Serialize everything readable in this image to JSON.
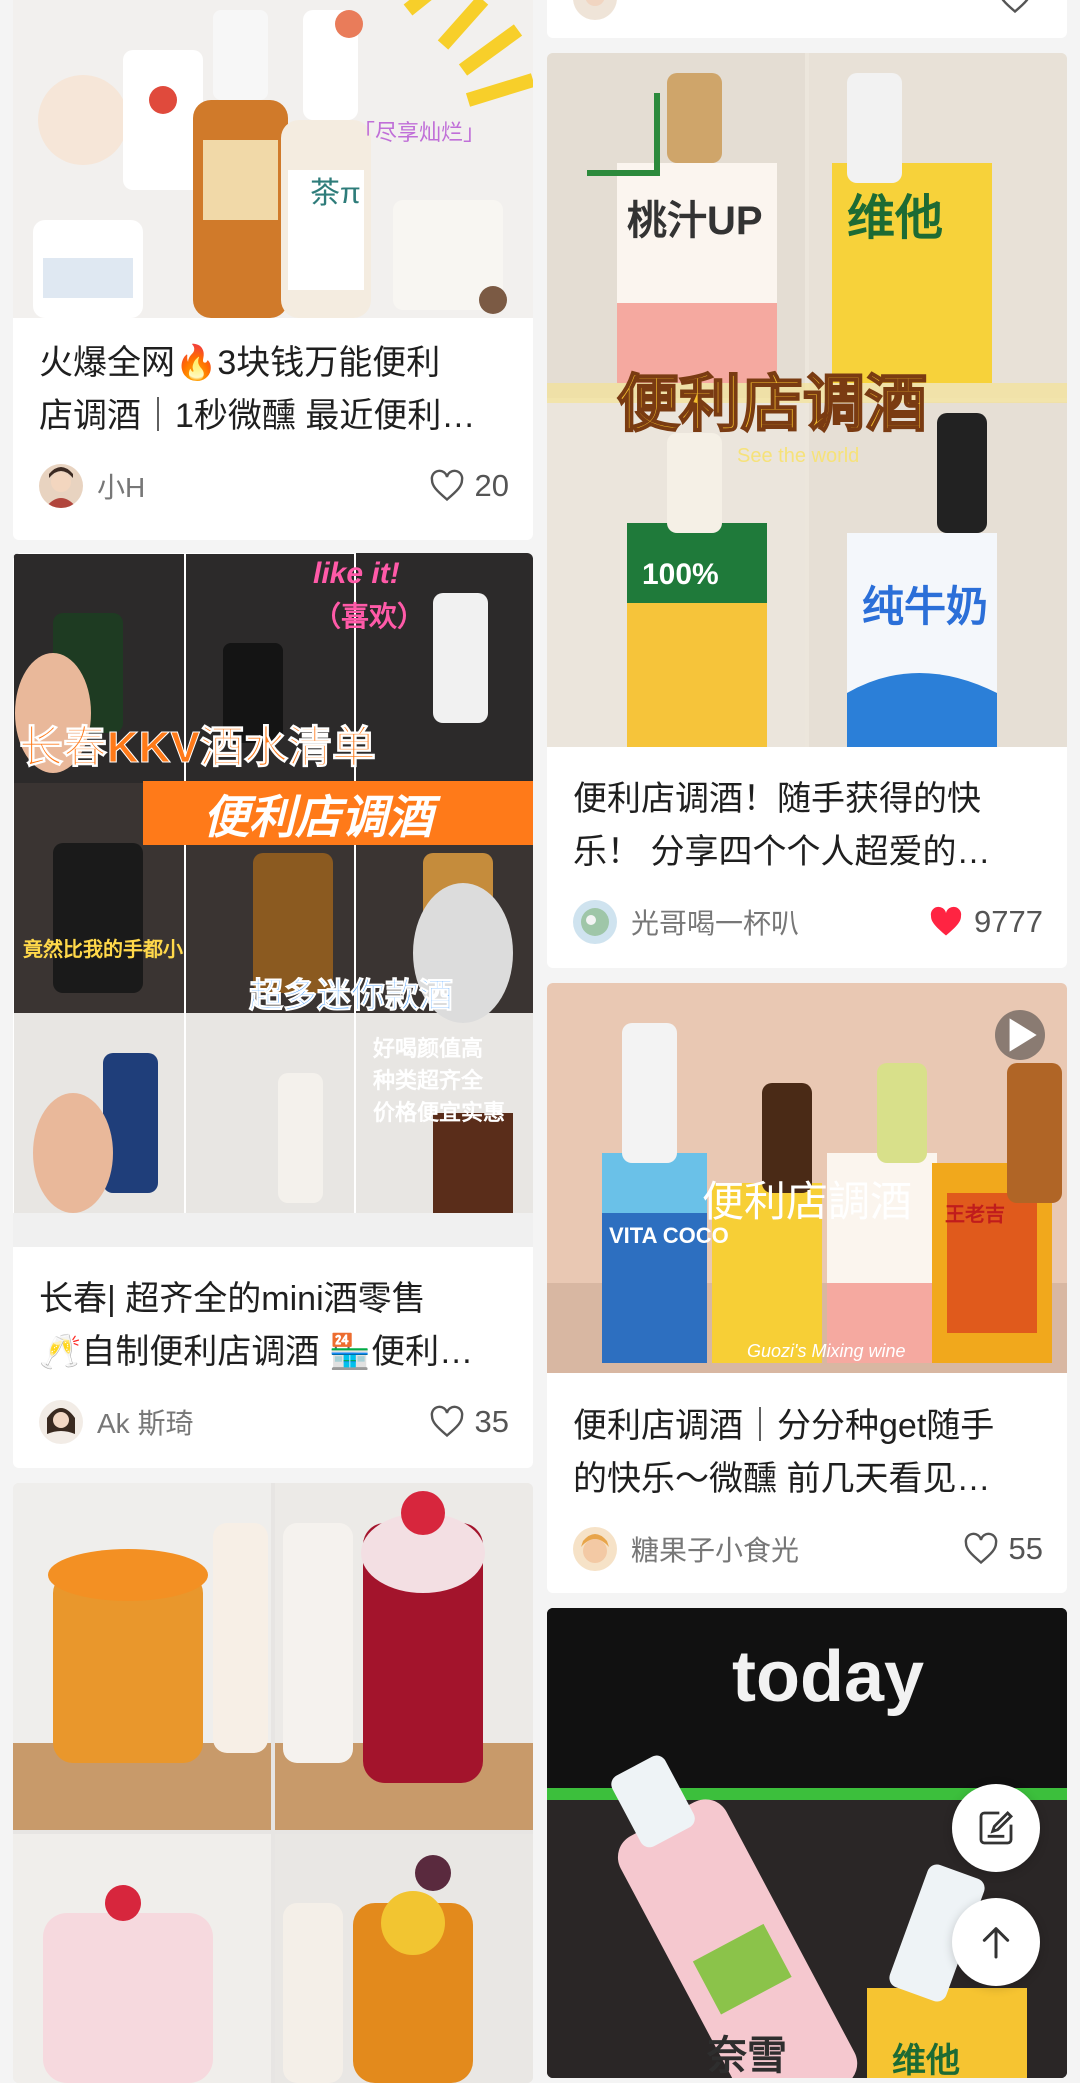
{
  "feed": {
    "cards": [
      {
        "title": "火爆全网🔥3块钱万能便利\n店调酒｜1秒微醺 最近便利…",
        "author": "小H",
        "likes": "20",
        "liked": false,
        "image_text": [
          "「尽享灿烂」",
          "茶π"
        ]
      },
      {
        "title": "长春| 超齐全的mini酒零售\n🥂自制便利店调酒 🏪便利…",
        "author": "Ak 斯琦",
        "likes": "35",
        "liked": false,
        "image_text": [
          "like it!",
          "（喜欢）",
          "长春KKV酒水清单",
          "便利店调酒",
          "超多迷你款酒",
          "好喝颜值高",
          "种类超齐全",
          "价格便宜实惠",
          "竟然比我的手都小"
        ]
      },
      {
        "title": "",
        "author": "",
        "likes": "",
        "image_text": []
      },
      {
        "title": "便利店调酒！随手获得的快\n乐！ 分享四个个人超爱的…",
        "author": "光哥喝一杯叭",
        "likes": "9777",
        "liked": true,
        "image_text": [
          "便利店调酒",
          "See the world",
          "纯牛奶",
          "桃汁UP",
          "100%",
          "维他"
        ]
      },
      {
        "title": "便利店调酒｜分分种get随手\n的快乐～微醺 前几天看见…",
        "author": "糖果子小食光",
        "likes": "55",
        "liked": false,
        "image_text": [
          "便利店調酒",
          "VITA COCO",
          "Guozi's Mixing wine",
          "王老吉"
        ]
      },
      {
        "title": "",
        "author": "",
        "likes": "",
        "image_text": [
          "today",
          "维他",
          "奈雪"
        ]
      }
    ]
  },
  "colors": {
    "liked": "#ff2442",
    "text": "#1f1f1f",
    "meta": "#777777",
    "bg": "#f4f4f4"
  },
  "icons": {
    "like": "heart-icon",
    "compose": "edit-note-icon",
    "top": "arrow-up-icon",
    "play": "play-icon"
  }
}
